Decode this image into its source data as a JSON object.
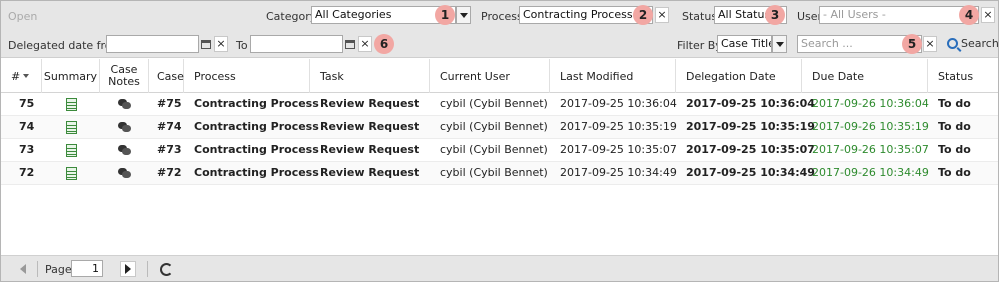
{
  "toolbar": {
    "open_label": "Open",
    "category_label": "Category",
    "category_value": "All Categories",
    "badge1": "1",
    "process_label": "Process",
    "process_value": "Contracting Process",
    "badge2": "2",
    "status_label": "Status",
    "status_value": "All Status",
    "badge3": "3",
    "user_label": "User",
    "user_placeholder": "- All Users -",
    "badge4": "4",
    "delegated_from_label": "Delegated date from",
    "to_label": "To",
    "badge6": "6",
    "filter_by_label": "Filter By",
    "filter_by_value": "Case Title",
    "search_placeholder": "Search ...",
    "badge5": "5",
    "search_button": "Search",
    "close_glyph": "×"
  },
  "table": {
    "headers": [
      "#",
      "Summary",
      "Case Notes",
      "Case",
      "Process",
      "Task",
      "Current User",
      "Last Modified",
      "Delegation Date",
      "Due Date",
      "Status"
    ],
    "rows": [
      {
        "num": "75",
        "case": "#75",
        "process": "Contracting Process",
        "task": "Review Request",
        "user": "cybil (Cybil Bennet)",
        "last_modified": "2017-09-25 10:36:04",
        "delegation": "2017-09-25 10:36:04",
        "due": "2017-09-26 10:36:04",
        "status": "To do"
      },
      {
        "num": "74",
        "case": "#74",
        "process": "Contracting Process",
        "task": "Review Request",
        "user": "cybil (Cybil Bennet)",
        "last_modified": "2017-09-25 10:35:19",
        "delegation": "2017-09-25 10:35:19",
        "due": "2017-09-26 10:35:19",
        "status": "To do"
      },
      {
        "num": "73",
        "case": "#73",
        "process": "Contracting Process",
        "task": "Review Request",
        "user": "cybil (Cybil Bennet)",
        "last_modified": "2017-09-25 10:35:07",
        "delegation": "2017-09-25 10:35:07",
        "due": "2017-09-26 10:35:07",
        "status": "To do"
      },
      {
        "num": "72",
        "case": "#72",
        "process": "Contracting Process",
        "task": "Review Request",
        "user": "cybil (Cybil Bennet)",
        "last_modified": "2017-09-25 10:34:49",
        "delegation": "2017-09-25 10:34:49",
        "due": "2017-09-26 10:34:49",
        "status": "To do"
      }
    ]
  },
  "pager": {
    "page_label": "Page",
    "page_value": "1"
  },
  "colors": {
    "due_date": "#2e8b2e",
    "badge": "#f2a7a3",
    "toolbar_bg": "#e6e6e6"
  },
  "icons": {
    "summary": "summary-sheet-icon",
    "case_notes": "speech-bubbles-icon",
    "calendar": "calendar-icon",
    "search": "magnifier-icon",
    "refresh": "refresh-icon"
  }
}
